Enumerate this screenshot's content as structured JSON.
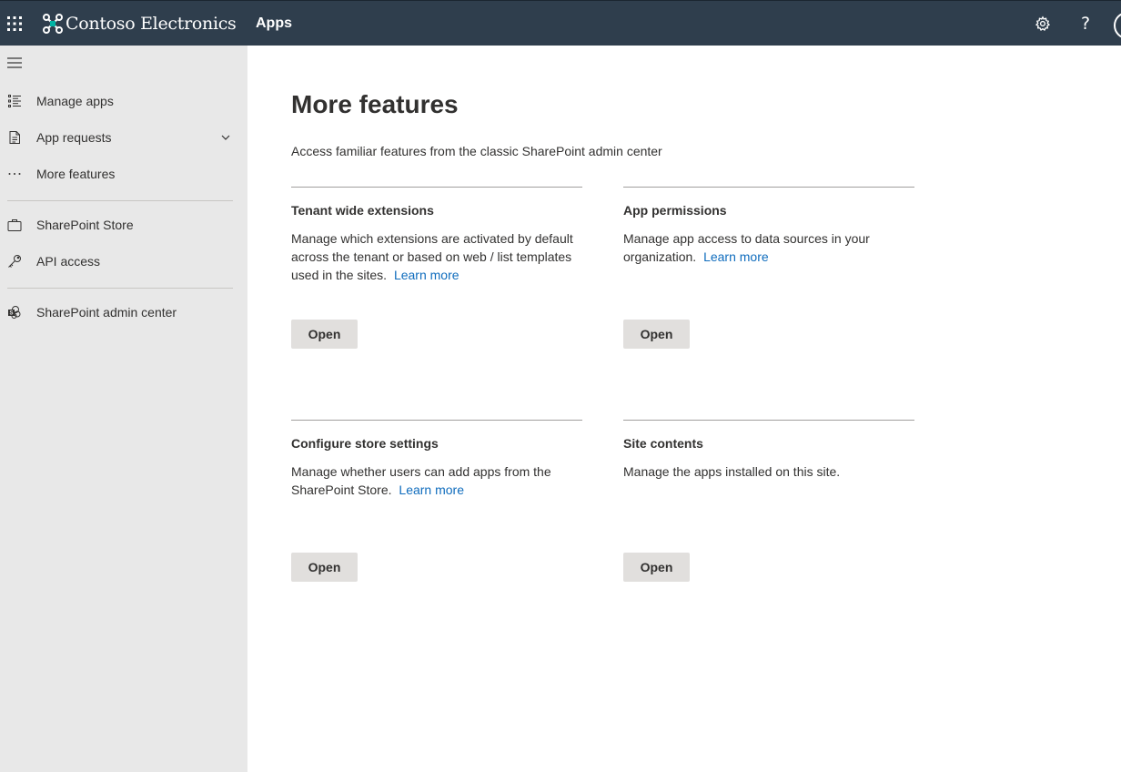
{
  "header": {
    "brand_name": "Contoso Electronics",
    "app_title": "Apps",
    "help_glyph": "?",
    "background_color": "#2f3e4d",
    "icons": [
      "waffle-icon",
      "contoso-logo",
      "gear-icon",
      "help-icon",
      "avatar"
    ]
  },
  "sidebar": {
    "background_color": "#e8e8e8",
    "items": [
      {
        "label": "Manage apps",
        "icon": "list-icon"
      },
      {
        "label": "App requests",
        "icon": "document-icon",
        "expandable": true
      },
      {
        "label": "More features",
        "icon": "ellipsis-icon"
      },
      {
        "label": "SharePoint Store",
        "icon": "briefcase-icon"
      },
      {
        "label": "API access",
        "icon": "key-icon"
      },
      {
        "label": "SharePoint admin center",
        "icon": "sharepoint-icon"
      }
    ]
  },
  "main": {
    "title": "More features",
    "description": "Access familiar features from the classic SharePoint admin center",
    "link_color": "#0f6cbd",
    "cards": [
      {
        "title": "Tenant wide extensions",
        "description": "Manage which extensions are activated by default across the tenant or based on web / list templates used in the sites.",
        "link": "Learn more",
        "button": "Open"
      },
      {
        "title": "App permissions",
        "description": "Manage app access to data sources in your organization.",
        "link": "Learn more",
        "button": "Open"
      },
      {
        "title": "Configure store settings",
        "description": "Manage whether users can add apps from the SharePoint Store.",
        "link": "Learn more",
        "button": "Open"
      },
      {
        "title": "Site contents",
        "description": "Manage the apps installed on this site.",
        "button": "Open"
      }
    ]
  }
}
